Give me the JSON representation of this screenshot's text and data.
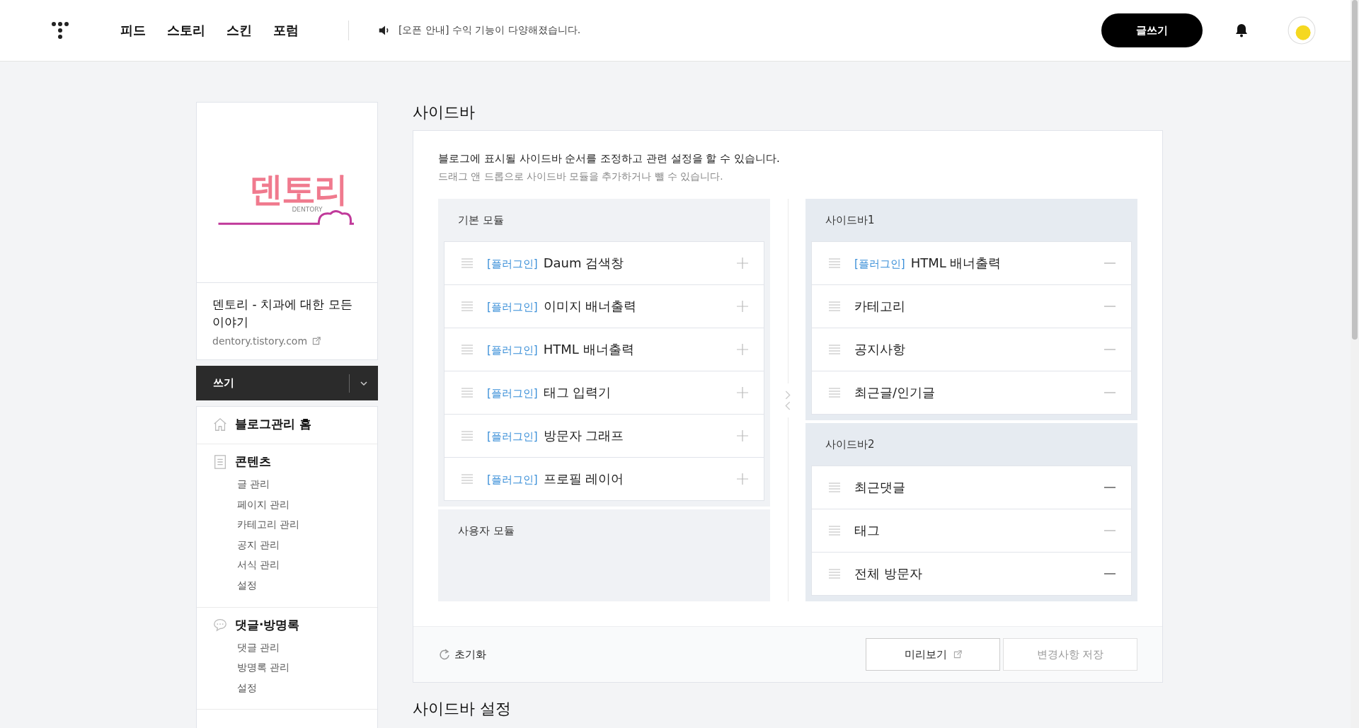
{
  "header": {
    "nav": [
      {
        "label": "피드"
      },
      {
        "label": "스토리"
      },
      {
        "label": "스킨"
      },
      {
        "label": "포럼"
      }
    ],
    "notice": "[오픈 안내] 수익 기능이 다양해졌습니다.",
    "write_button": "글쓰기"
  },
  "blog": {
    "logo_text": "덴토리",
    "logo_subtext": "DENTORY",
    "title": "덴토리 - 치과에 대한 모든 이야기",
    "url": "dentory.tistory.com",
    "write_bar": "쓰기"
  },
  "menu": [
    {
      "label": "블로그관리 홈",
      "kind": "home"
    },
    {
      "label": "콘텐츠",
      "kind": "document",
      "children": [
        {
          "label": "글 관리"
        },
        {
          "label": "페이지 관리"
        },
        {
          "label": "카테고리 관리"
        },
        {
          "label": "공지 관리"
        },
        {
          "label": "서식 관리"
        },
        {
          "label": "설정"
        }
      ]
    },
    {
      "label": "댓글·방명록",
      "kind": "comment",
      "children": [
        {
          "label": "댓글 관리"
        },
        {
          "label": "방명록 관리"
        },
        {
          "label": "설정"
        }
      ]
    }
  ],
  "page_title": "사이드바",
  "description": "블로그에 표시될 사이드바 순서를 조정하고 관련 설정을 할 수 있습니다.",
  "hint": "드래그 앤 드롭으로 사이드바 모듈을 추가하거나 뺄 수 있습니다.",
  "basic_modules": {
    "title": "기본 모듈",
    "items": [
      {
        "tag": "[플러그인]",
        "name": "Daum 검색창"
      },
      {
        "tag": "[플러그인]",
        "name": "이미지 배너출력"
      },
      {
        "tag": "[플러그인]",
        "name": "HTML 배너출력"
      },
      {
        "tag": "[플러그인]",
        "name": "태그 입력기"
      },
      {
        "tag": "[플러그인]",
        "name": "방문자 그래프"
      },
      {
        "tag": "[플러그인]",
        "name": "프로필 레이어"
      }
    ]
  },
  "user_modules": {
    "title": "사용자 모듈"
  },
  "sidebars": [
    {
      "title": "사이드바1",
      "items": [
        {
          "tag": "[플러그인]",
          "name": "HTML 배너출력",
          "highlighted": false
        },
        {
          "name": "카테고리",
          "highlighted": false
        },
        {
          "name": "공지사항",
          "highlighted": false
        },
        {
          "name": "최근글/인기글",
          "highlighted": false
        }
      ]
    },
    {
      "title": "사이드바2",
      "items": [
        {
          "name": "최근댓글",
          "highlighted": true
        },
        {
          "name": "태그",
          "highlighted": false
        },
        {
          "name": "전체 방문자",
          "highlighted": true
        }
      ]
    }
  ],
  "footer": {
    "reset": "초기화",
    "buttons": [
      {
        "label": "미리보기",
        "kind": "preview",
        "disabled": false
      },
      {
        "label": "변경사항 저장",
        "kind": "save",
        "disabled": true
      }
    ]
  },
  "next_section_title": "사이드바 설정"
}
